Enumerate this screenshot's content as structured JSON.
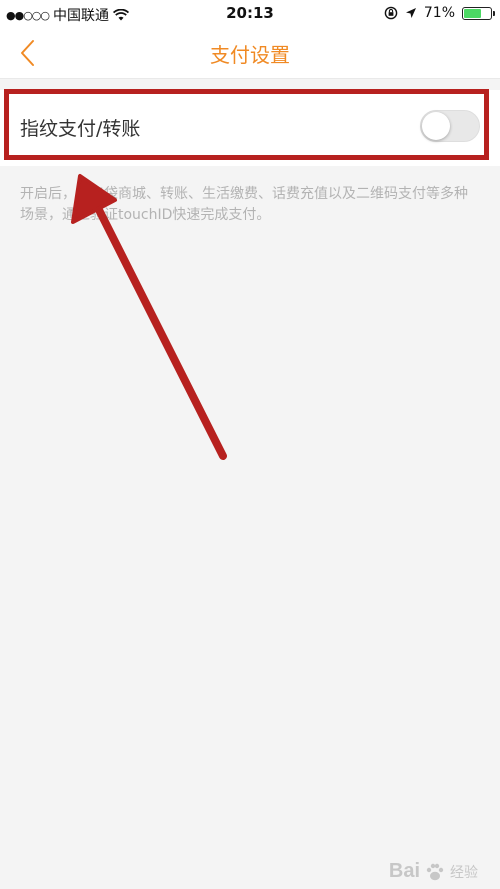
{
  "status_bar": {
    "signal_dots": "●●○○○",
    "carrier": "中国联通",
    "time": "20:13",
    "battery_percent": "71%",
    "battery_level": 0.71,
    "icons": [
      "wifi-icon",
      "rotation-lock-icon",
      "location-arrow-icon",
      "battery-icon"
    ]
  },
  "nav": {
    "title": "支付设置",
    "back_icon": "chevron-left-icon",
    "accent_color": "#f08a24"
  },
  "setting": {
    "label": "指纹支付/转账",
    "toggle_on": false,
    "description": "开启后，在口袋商城、转账、生活缴费、话费充值以及二维码支付等多种场景，通过验证touchID快速完成支付。"
  },
  "annotation": {
    "highlight_color": "#b7211f"
  },
  "watermark": {
    "brand": "Bai",
    "suffix": "经验"
  }
}
